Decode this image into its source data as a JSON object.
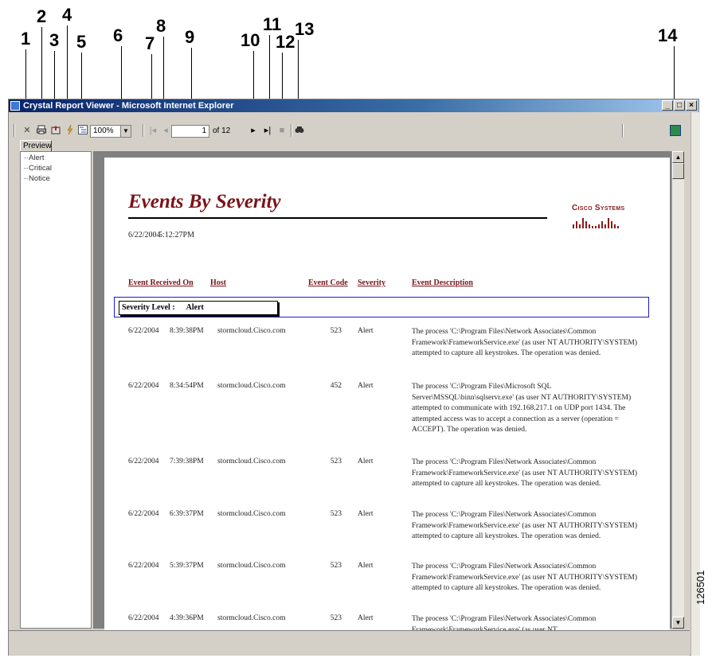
{
  "callouts": [
    "1",
    "2",
    "3",
    "4",
    "5",
    "6",
    "7",
    "8",
    "9",
    "10",
    "11",
    "12",
    "13",
    "14"
  ],
  "window": {
    "title": "Crystal Report Viewer - Microsoft Internet Explorer",
    "controls": [
      "_",
      "□",
      "×"
    ]
  },
  "toolbar": {
    "zoom": "100%",
    "page_current": "1",
    "page_of": "of 12"
  },
  "tabs": [
    "Preview"
  ],
  "tree": [
    "Alert",
    "Critical",
    "Notice"
  ],
  "report": {
    "title": "Events By Severity",
    "date": "6/22/2004",
    "time": "5:12:27PM",
    "logo_text": "Cisco Systems",
    "columns": [
      "Event Received On",
      "Host",
      "Event Code",
      "Severity",
      "Event Description"
    ],
    "severity_label": "Severity Level :",
    "severity_value": "Alert",
    "rows": [
      {
        "date": "6/22/2004",
        "time": "8:39:38PM",
        "host": "stormcloud.Cisco.com",
        "code": "523",
        "severity": "Alert",
        "desc": "The process 'C:\\Program Files\\Network Associates\\Common Framework\\FrameworkService.exe' (as user NT AUTHORITY\\SYSTEM) attempted to capture all keystrokes. The operation was denied."
      },
      {
        "date": "6/22/2004",
        "time": "8:34:54PM",
        "host": "stormcloud.Cisco.com",
        "code": "452",
        "severity": "Alert",
        "desc": "The process 'C:\\Program Files\\Microsoft SQL Server\\MSSQL\\binn\\sqlservr.exe' (as user NT AUTHORITY\\SYSTEM) attempted to communicate with 192.168.217.1 on UDP port 1434. The attempted access was to accept a connection as a server (operation = ACCEPT). The operation was denied."
      },
      {
        "date": "6/22/2004",
        "time": "7:39:38PM",
        "host": "stormcloud.Cisco.com",
        "code": "523",
        "severity": "Alert",
        "desc": "The process 'C:\\Program Files\\Network Associates\\Common Framework\\FrameworkService.exe' (as user NT AUTHORITY\\SYSTEM) attempted to capture all keystrokes. The operation was denied."
      },
      {
        "date": "6/22/2004",
        "time": "6:39:37PM",
        "host": "stormcloud.Cisco.com",
        "code": "523",
        "severity": "Alert",
        "desc": "The process 'C:\\Program Files\\Network Associates\\Common Framework\\FrameworkService.exe' (as user NT AUTHORITY\\SYSTEM) attempted to capture all keystrokes. The operation was denied."
      },
      {
        "date": "6/22/2004",
        "time": "5:39:37PM",
        "host": "stormcloud.Cisco.com",
        "code": "523",
        "severity": "Alert",
        "desc": "The process 'C:\\Program Files\\Network Associates\\Common Framework\\FrameworkService.exe' (as user NT AUTHORITY\\SYSTEM) attempted to capture all keystrokes. The operation was denied."
      },
      {
        "date": "6/22/2004",
        "time": "4:39:36PM",
        "host": "stormcloud.Cisco.com",
        "code": "523",
        "severity": "Alert",
        "desc": "The process 'C:\\Program Files\\Network Associates\\Common Framework\\FrameworkService.exe' (as user NT"
      }
    ]
  },
  "figure_number": "126501"
}
